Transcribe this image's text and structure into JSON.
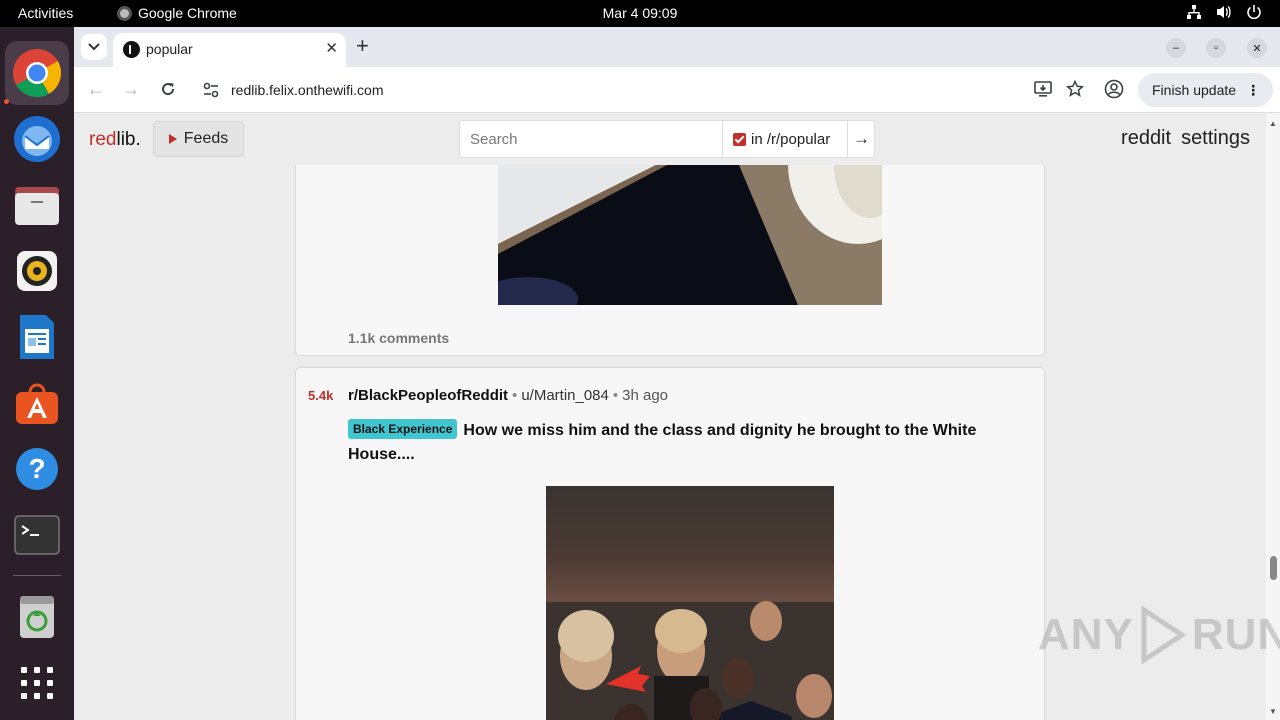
{
  "topbar": {
    "activities": "Activities",
    "app_name": "Google Chrome",
    "clock": "Mar 4  09:09"
  },
  "dock": {
    "items": [
      "chrome-icon",
      "thunderbird-icon",
      "files-icon",
      "rhythmbox-icon",
      "libreoffice-writer-icon",
      "app-center-icon",
      "help-icon",
      "terminal-icon",
      "trash-icon",
      "app-grid-icon"
    ]
  },
  "browser": {
    "tab_title": "popular",
    "url": "redlib.felix.onthewifi.com",
    "finish_update": "Finish update"
  },
  "site": {
    "logo_red": "red",
    "logo_black": "lib.",
    "feeds_label": "Feeds",
    "search_placeholder": "Search",
    "search_scope": "in /r/popular",
    "search_go": "→",
    "nav_reddit": "reddit",
    "nav_settings": "settings"
  },
  "posts": [
    {
      "comments": "1.1k comments"
    },
    {
      "score": "5.4k",
      "subreddit": "r/BlackPeopleofReddit",
      "author": "u/Martin_084",
      "time": "3h ago",
      "flair": "Black Experience",
      "title": "How we miss him and the class and dignity he brought to the White House...."
    }
  ],
  "watermark": {
    "left": "ANY",
    "right": "RUN"
  },
  "colors": {
    "accent_red": "#c3302c",
    "flair": "#40c6d0",
    "ubuntu_orange": "#e95420"
  }
}
